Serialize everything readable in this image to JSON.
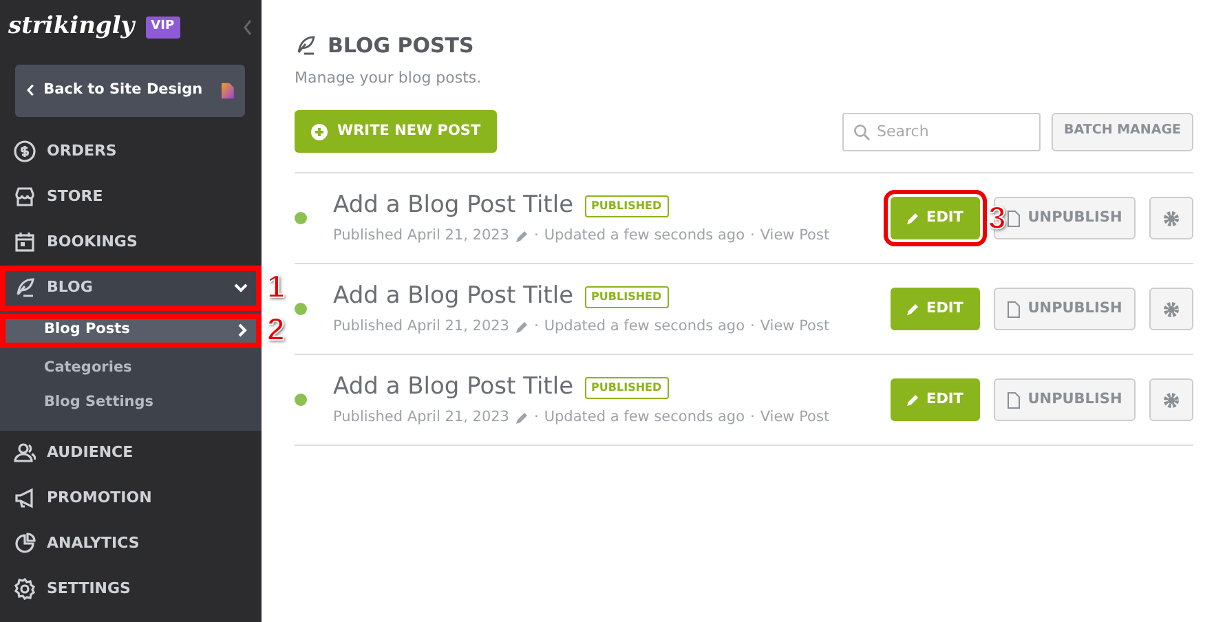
{
  "brand": {
    "logo": "strikingly",
    "badge": "VIP"
  },
  "back_button": "Back to Site Design",
  "nav": [
    {
      "label": "ORDERS"
    },
    {
      "label": "STORE"
    },
    {
      "label": "BOOKINGS"
    },
    {
      "label": "BLOG",
      "expanded": true,
      "callout": "1",
      "children": [
        {
          "label": "Blog Posts",
          "selected": true,
          "callout": "2"
        },
        {
          "label": "Categories",
          "selected": false
        },
        {
          "label": "Blog Settings",
          "selected": false
        }
      ]
    },
    {
      "label": "AUDIENCE"
    },
    {
      "label": "PROMOTION"
    },
    {
      "label": "ANALYTICS"
    },
    {
      "label": "SETTINGS"
    }
  ],
  "header": {
    "title": "BLOG POSTS",
    "subtitle": "Manage your blog posts."
  },
  "write_button": "WRITE NEW POST",
  "search": {
    "placeholder": "Search"
  },
  "batch_button": "BATCH MANAGE",
  "separator": "·",
  "posts": [
    {
      "title": "Add a Blog Post Title",
      "status": "PUBLISHED",
      "published": "Published April 21, 2023",
      "updated": "Updated a few seconds ago",
      "view": "View Post",
      "edit": "EDIT",
      "unpublish": "UNPUBLISH",
      "callout": "3"
    },
    {
      "title": "Add a Blog Post Title",
      "status": "PUBLISHED",
      "published": "Published April 21, 2023",
      "updated": "Updated a few seconds ago",
      "view": "View Post",
      "edit": "EDIT",
      "unpublish": "UNPUBLISH"
    },
    {
      "title": "Add a Blog Post Title",
      "status": "PUBLISHED",
      "published": "Published April 21, 2023",
      "updated": "Updated a few seconds ago",
      "view": "View Post",
      "edit": "EDIT",
      "unpublish": "UNPUBLISH"
    }
  ]
}
